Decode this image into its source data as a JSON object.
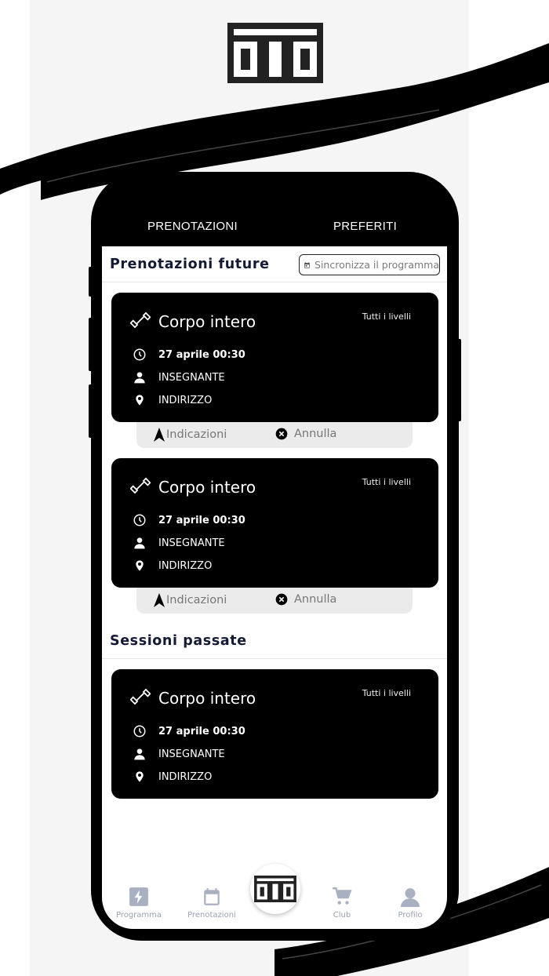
{
  "header": {
    "logo_alt": "OTO"
  },
  "top_tabs": [
    {
      "label": "PRENOTAZIONI"
    },
    {
      "label": "PREFERITI"
    }
  ],
  "future": {
    "title": "Prenotazioni future",
    "sync_label": "Sincronizza il programma",
    "cards": [
      {
        "title": "Corpo intero",
        "level": "Tutti i livelli",
        "datetime": "27 aprile 00:30",
        "teacher": "INSEGNANTE",
        "address": "INDIRIZZO",
        "directions_label": "Indicazioni",
        "cancel_label": "Annulla"
      },
      {
        "title": "Corpo intero",
        "level": "Tutti i livelli",
        "datetime": "27 aprile 00:30",
        "teacher": "INSEGNANTE",
        "address": "INDIRIZZO",
        "directions_label": "Indicazioni",
        "cancel_label": "Annulla"
      }
    ]
  },
  "past": {
    "title": "Sessioni passate",
    "cards": [
      {
        "title": "Corpo intero",
        "level": "Tutti i livelli",
        "datetime": "27 aprile 00:30",
        "teacher": "INSEGNANTE",
        "address": "INDIRIZZO"
      }
    ]
  },
  "bottom_nav": {
    "items": [
      {
        "label": "Programma",
        "icon": "bolt-icon"
      },
      {
        "label": "Prenotazioni",
        "icon": "calendar-icon"
      },
      {
        "label": "",
        "icon": "oto-logo-icon"
      },
      {
        "label": "Club",
        "icon": "cart-icon"
      },
      {
        "label": "Profilo",
        "icon": "user-icon"
      }
    ]
  },
  "colors": {
    "background_band": "#f5f5f5",
    "phone": "#000000",
    "card": "#000000",
    "title_text": "#141a33",
    "nav_inactive": "#9aa1b3",
    "actions_bg": "#ebebeb"
  }
}
